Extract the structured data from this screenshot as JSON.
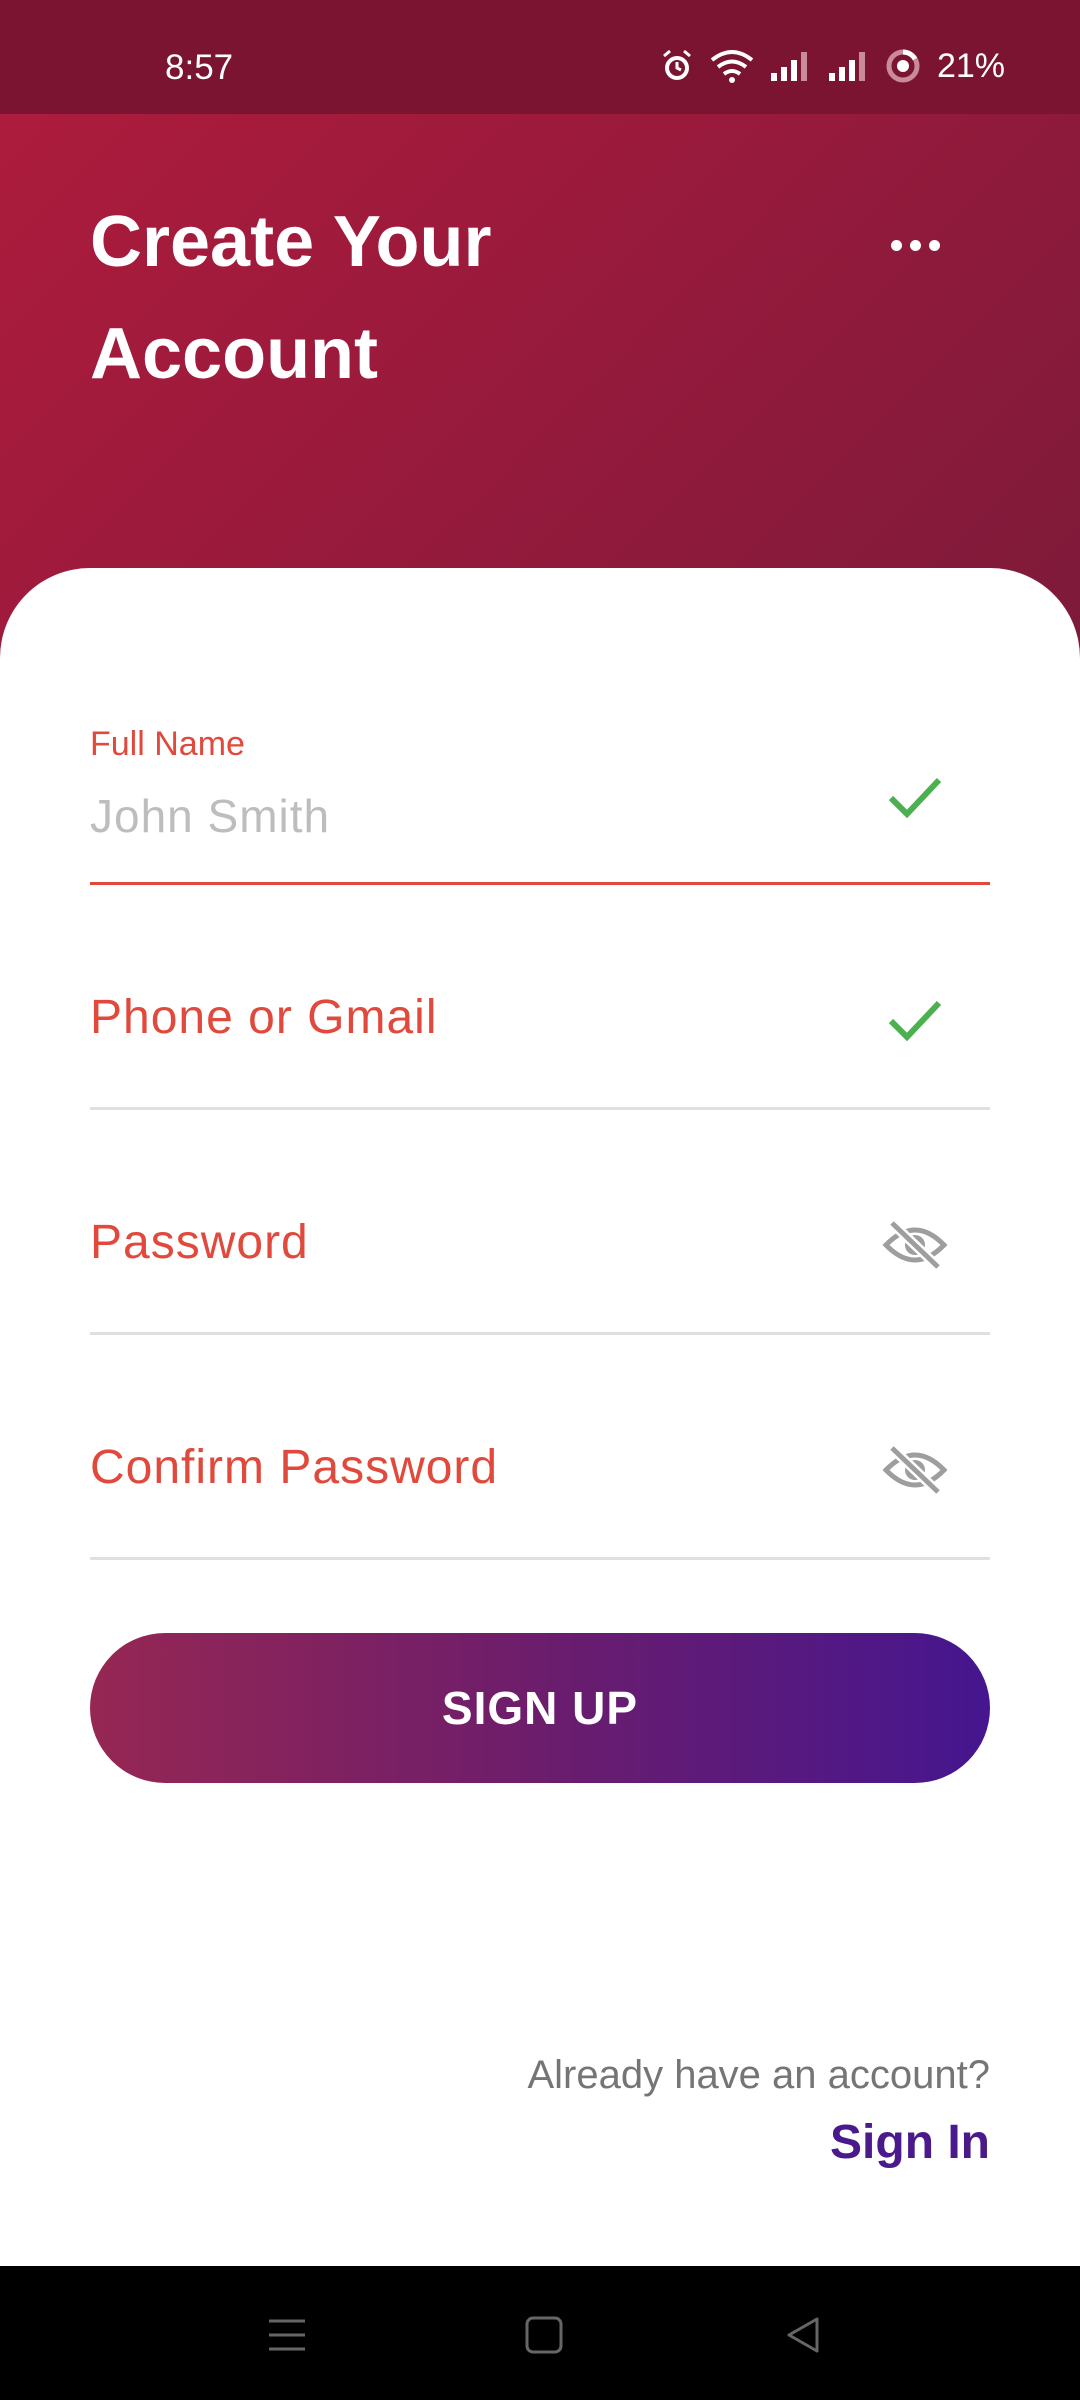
{
  "status_bar": {
    "time": "8:57",
    "battery": "21%"
  },
  "header": {
    "title": "Create Your Account",
    "more_icon": "more-horizontal-icon"
  },
  "form": {
    "full_name": {
      "label": "Full Name",
      "value": "John Smith",
      "status_icon": "check-icon"
    },
    "contact": {
      "label": "Phone or Gmail",
      "status_icon": "check-icon"
    },
    "password": {
      "label": "Password",
      "toggle_icon": "eye-off-icon"
    },
    "confirm_password": {
      "label": "Confirm Password",
      "toggle_icon": "eye-off-icon"
    },
    "submit_label": "SIGN UP"
  },
  "footer": {
    "prompt": "Already have an account?",
    "link_label": "Sign In"
  },
  "colors": {
    "accent_red": "#e0493c",
    "check_green": "#4caf50",
    "link_purple": "#4a1a8c",
    "header_top": "#b01c3c",
    "button_start": "#962753",
    "button_end": "#45168f"
  }
}
